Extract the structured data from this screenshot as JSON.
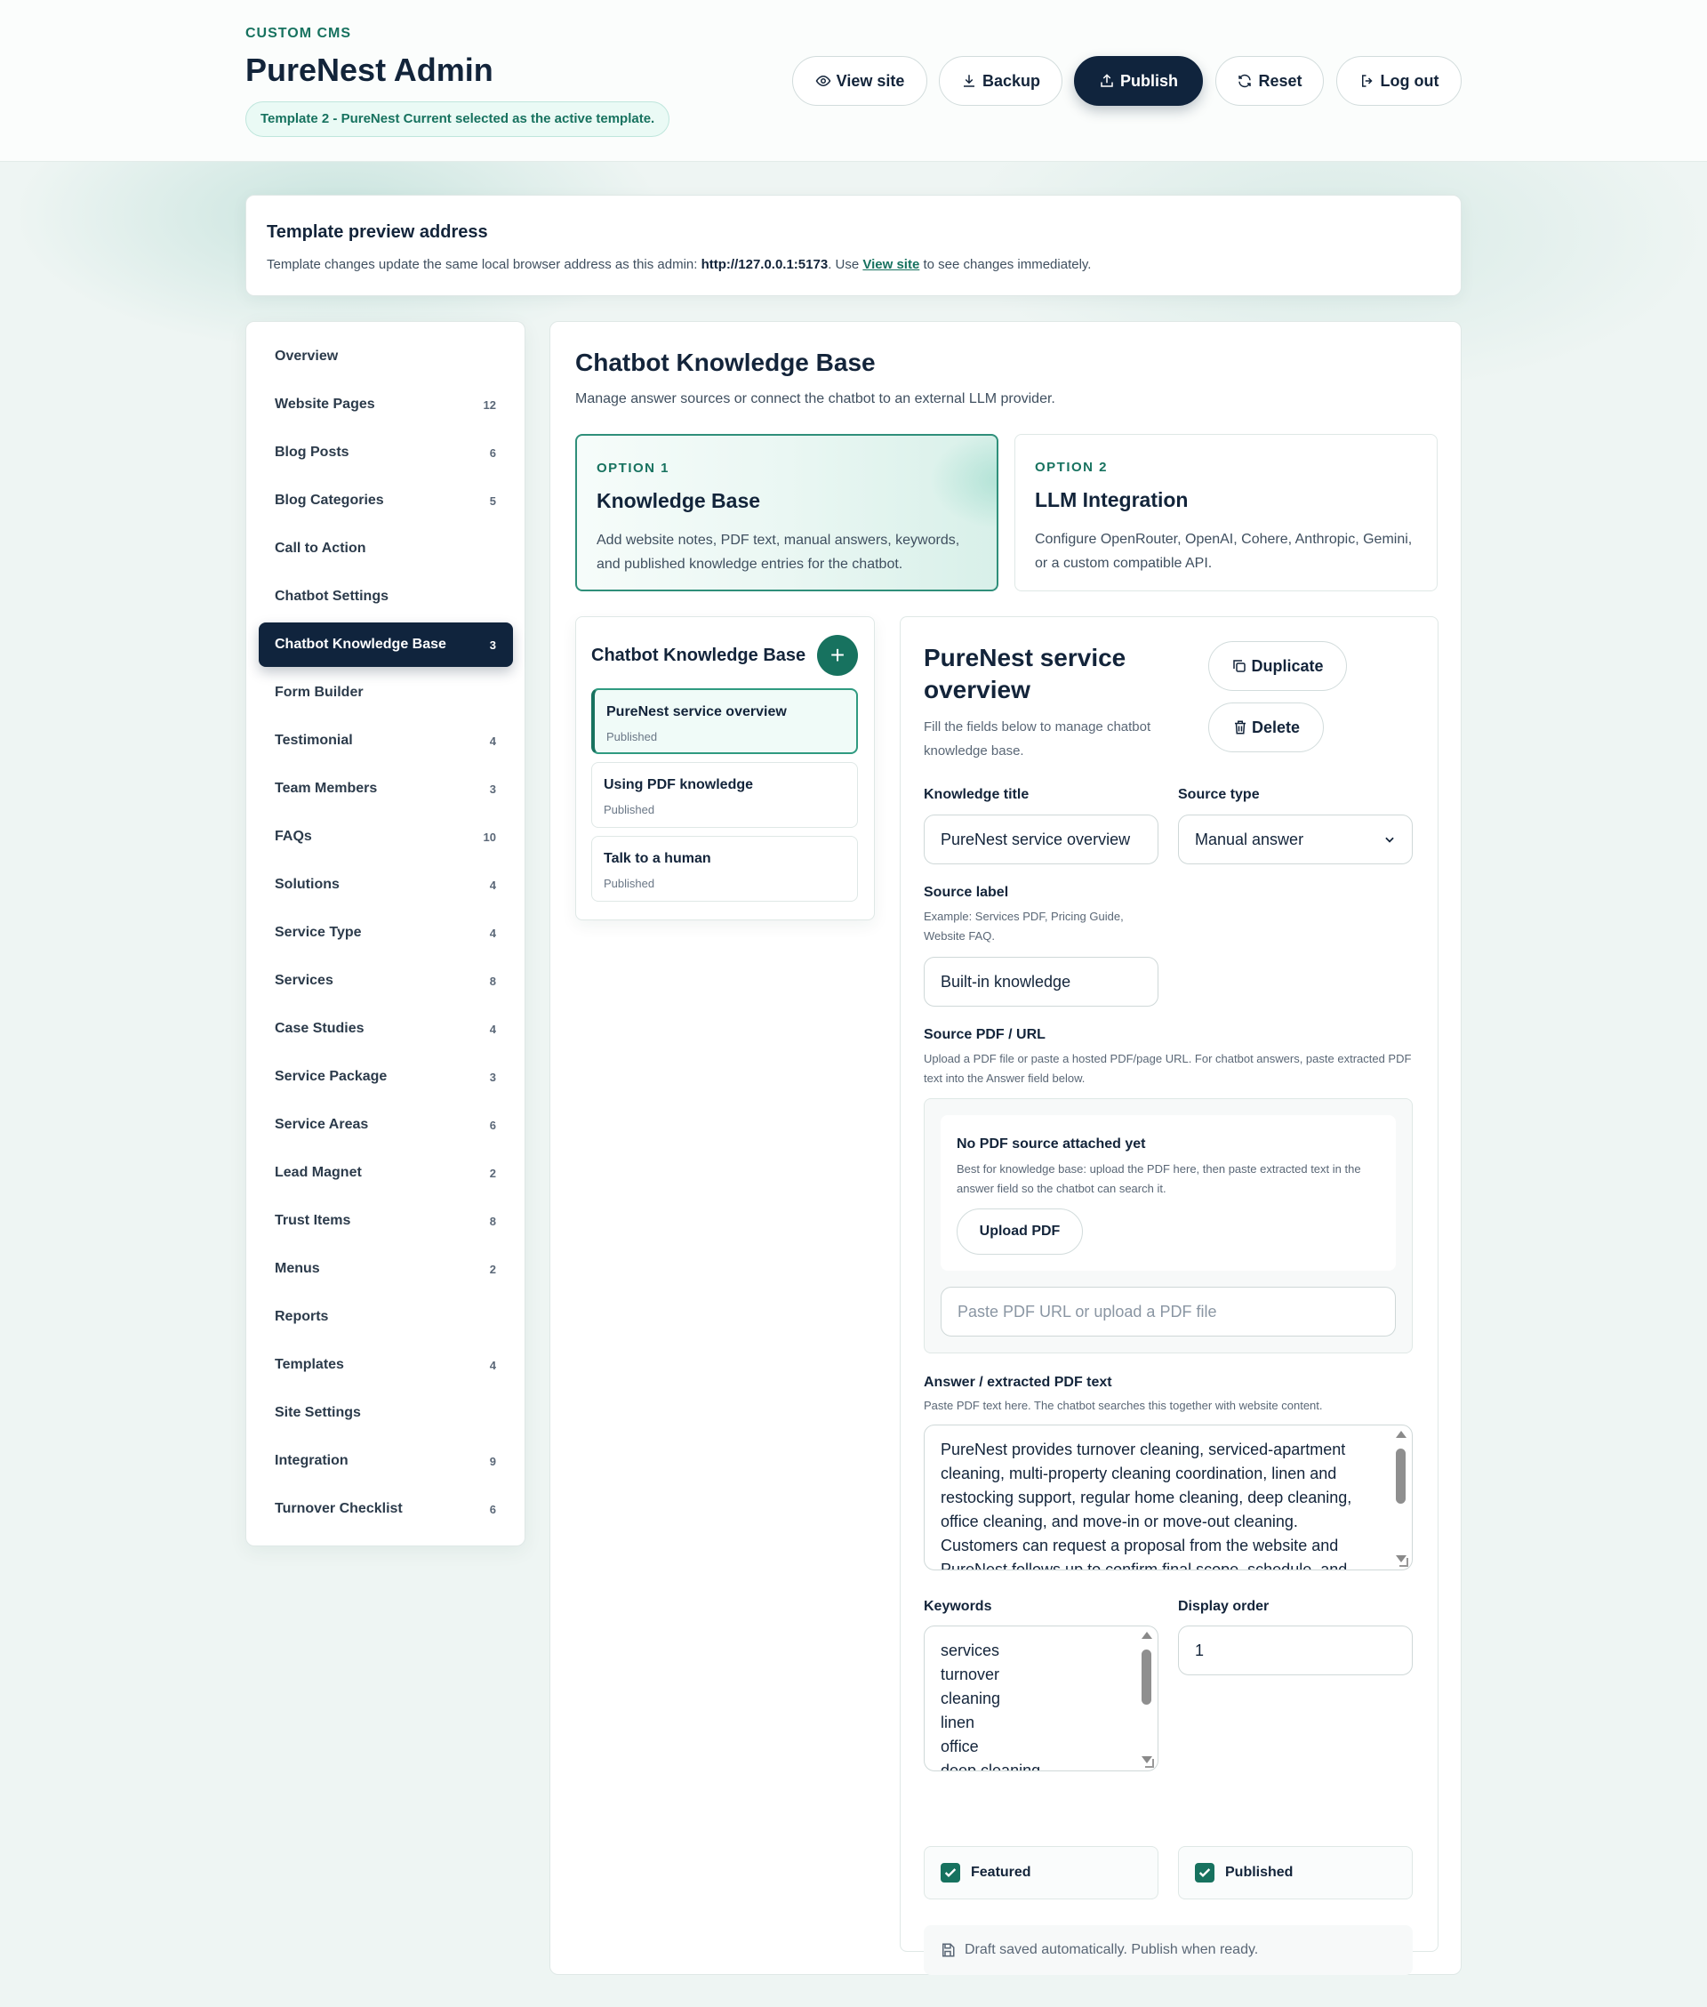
{
  "header": {
    "eyebrow": "CUSTOM CMS",
    "title": "PureNest Admin",
    "active_template": "Template 2 - PureNest Current selected as the active template.",
    "buttons": {
      "view_site": "View site",
      "backup": "Backup",
      "publish": "Publish",
      "reset": "Reset",
      "logout": "Log out"
    }
  },
  "preview": {
    "title": "Template preview address",
    "text_before": "Template changes update the same local browser address as this admin: ",
    "address": "http://127.0.0.1:5173",
    "text_mid": ". Use ",
    "link": "View site",
    "text_after": " to see changes immediately."
  },
  "sidebar": {
    "items": [
      {
        "label": "Overview",
        "count": ""
      },
      {
        "label": "Website Pages",
        "count": "12"
      },
      {
        "label": "Blog Posts",
        "count": "6"
      },
      {
        "label": "Blog Categories",
        "count": "5"
      },
      {
        "label": "Call to Action",
        "count": ""
      },
      {
        "label": "Chatbot Settings",
        "count": ""
      },
      {
        "label": "Chatbot Knowledge Base",
        "count": "3",
        "active": true
      },
      {
        "label": "Form Builder",
        "count": ""
      },
      {
        "label": "Testimonial",
        "count": "4"
      },
      {
        "label": "Team Members",
        "count": "3"
      },
      {
        "label": "FAQs",
        "count": "10"
      },
      {
        "label": "Solutions",
        "count": "4"
      },
      {
        "label": "Service Type",
        "count": "4"
      },
      {
        "label": "Services",
        "count": "8"
      },
      {
        "label": "Case Studies",
        "count": "4"
      },
      {
        "label": "Service Package",
        "count": "3"
      },
      {
        "label": "Service Areas",
        "count": "6"
      },
      {
        "label": "Lead Magnet",
        "count": "2"
      },
      {
        "label": "Trust Items",
        "count": "8"
      },
      {
        "label": "Menus",
        "count": "2"
      },
      {
        "label": "Reports",
        "count": ""
      },
      {
        "label": "Templates",
        "count": "4"
      },
      {
        "label": "Site Settings",
        "count": ""
      },
      {
        "label": "Integration",
        "count": "9"
      },
      {
        "label": "Turnover Checklist",
        "count": "6"
      }
    ]
  },
  "main": {
    "title": "Chatbot Knowledge Base",
    "subtitle": "Manage answer sources or connect the chatbot to an external LLM provider.",
    "options": [
      {
        "label": "OPTION 1",
        "title": "Knowledge Base",
        "desc": "Add website notes, PDF text, manual answers, keywords, and published knowledge entries for the chatbot."
      },
      {
        "label": "OPTION 2",
        "title": "LLM Integration",
        "desc": "Configure OpenRouter, OpenAI, Cohere, Anthropic, Gemini, or a custom compatible API."
      }
    ],
    "list": {
      "title": "Chatbot Knowledge Base",
      "add_label": "+",
      "items": [
        {
          "name": "PureNest service overview",
          "status": "Published"
        },
        {
          "name": "Using PDF knowledge",
          "status": "Published"
        },
        {
          "name": "Talk to a human",
          "status": "Published"
        }
      ]
    },
    "editor": {
      "title": "PureNest service overview",
      "subtitle": "Fill the fields below to manage chatbot knowledge base.",
      "duplicate": "Duplicate",
      "delete": "Delete",
      "knowledge_title_label": "Knowledge title",
      "knowledge_title_value": "PureNest service overview",
      "source_type_label": "Source type",
      "source_type_value": "Manual answer",
      "source_label_label": "Source label",
      "source_label_help": "Example: Services PDF, Pricing Guide, Website FAQ.",
      "source_label_value": "Built-in knowledge",
      "source_pdf_label": "Source PDF / URL",
      "source_pdf_help": "Upload a PDF file or paste a hosted PDF/page URL. For chatbot answers, paste extracted PDF text into the Answer field below.",
      "pdf_empty_title": "No PDF source attached yet",
      "pdf_empty_help": "Best for knowledge base: upload the PDF here, then paste extracted text in the answer field so the chatbot can search it.",
      "upload_pdf": "Upload PDF",
      "pdf_url_placeholder": "Paste PDF URL or upload a PDF file",
      "answer_label": "Answer / extracted PDF text",
      "answer_help": "Paste PDF text here. The chatbot searches this together with website content.",
      "answer_lines": [
        "PureNest provides turnover cleaning, serviced-apartment",
        "cleaning, multi-property cleaning coordination, linen and",
        "restocking support, regular home cleaning, deep cleaning,",
        "office cleaning, and move-in or move-out cleaning.",
        "Customers can request a proposal from the website and",
        "PureNest follows up to confirm final scope, schedule, and"
      ],
      "keywords_label": "Keywords",
      "keywords": [
        "services",
        "turnover",
        "cleaning",
        "linen",
        "office",
        "deep cleaning"
      ],
      "display_order_label": "Display order",
      "display_order_value": "1",
      "featured_label": "Featured",
      "featured": true,
      "published_label": "Published",
      "published": true,
      "draft_notice": "Draft saved automatically. Publish when ready."
    }
  },
  "colors": {
    "brand": "#17725f",
    "navy": "#10243d",
    "background": "#eef5f3"
  }
}
